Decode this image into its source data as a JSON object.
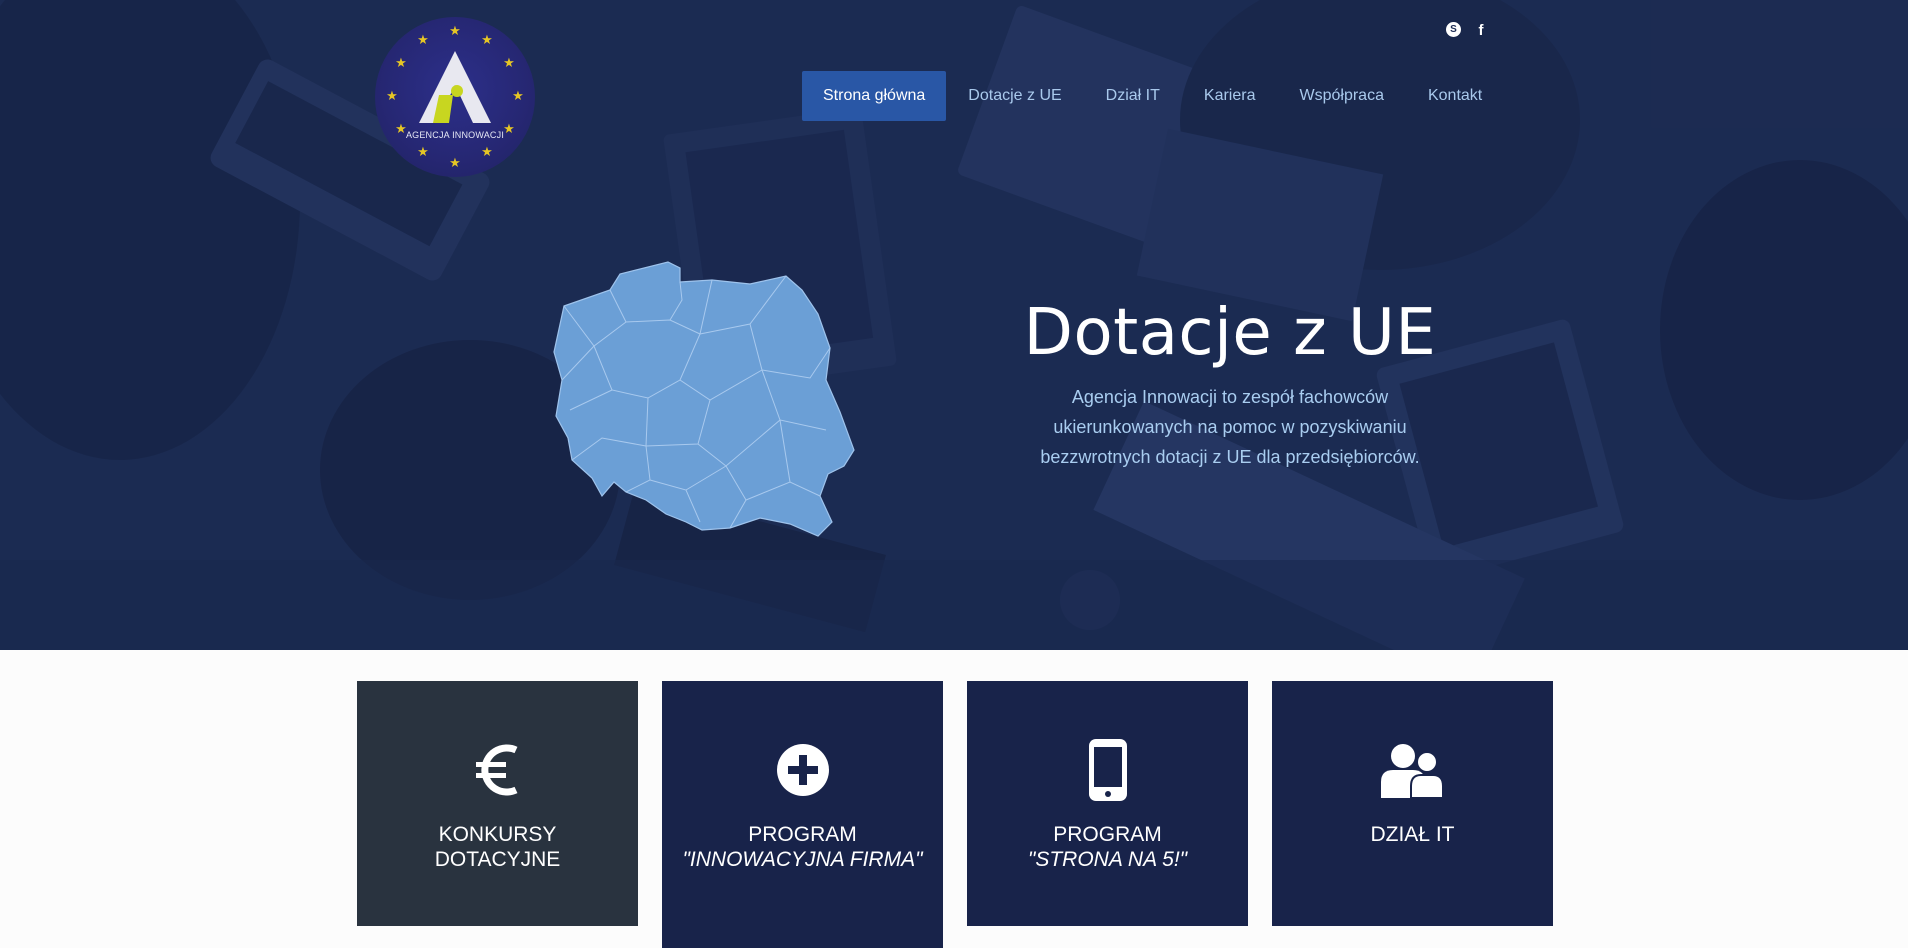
{
  "logo": {
    "text": "AGENCJA INNOWACJI"
  },
  "social": {
    "skype_icon": "skype-icon",
    "facebook_icon": "facebook-icon"
  },
  "nav": {
    "items": [
      {
        "label": "Strona główna",
        "active": true
      },
      {
        "label": "Dotacje z UE"
      },
      {
        "label": "Dział IT"
      },
      {
        "label": "Kariera"
      },
      {
        "label": "Współpraca"
      },
      {
        "label": "Kontakt"
      }
    ]
  },
  "hero": {
    "title": "Dotacje z UE",
    "description": "Agencja Innowacji to zespół fachowców ukierunkowanych na pomoc w pozyskiwaniu bezzwrotnych dotacji z UE dla przedsiębiorców."
  },
  "cards": [
    {
      "icon": "euro-icon",
      "line1": "KONKURSY",
      "line2": "DOTACYJNE"
    },
    {
      "icon": "plus-circle-icon",
      "line1": "PROGRAM",
      "line2": "\"INNOWACYJNA FIRMA\""
    },
    {
      "icon": "smartphone-icon",
      "line1": "PROGRAM",
      "line2": "\"STRONA NA 5!\""
    },
    {
      "icon": "users-icon",
      "line1": "DZIAŁ IT",
      "line2": ""
    }
  ],
  "colors": {
    "nav_active": "#2957a6",
    "nav_text": "#a9c9ec",
    "card_navy": "#18234a",
    "card_dark": "#29333f",
    "map_fill": "#6b9fd6"
  }
}
